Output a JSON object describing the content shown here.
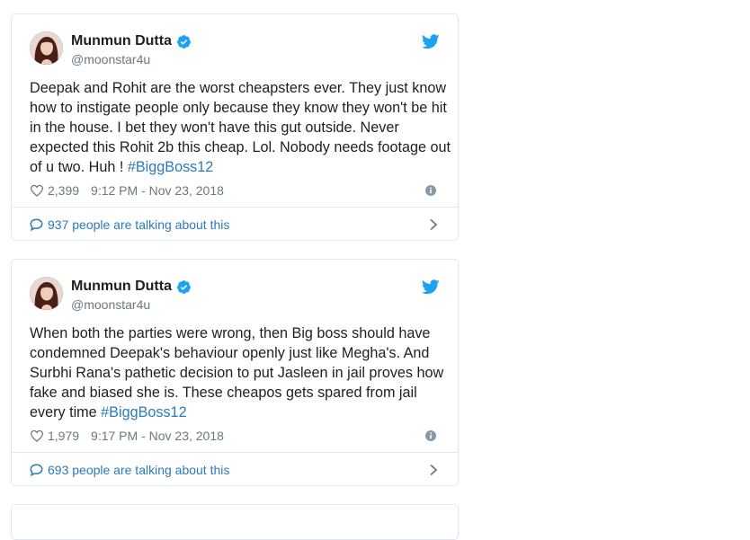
{
  "tweets": [
    {
      "author_name": "Munmun Dutta",
      "handle": "@moonstar4u",
      "text": "Deepak and Rohit are the worst cheapsters ever. They just know how to instigate people only because they know they won't be hit in the house. I bet they won't have this gut outside. Never expected this Rohit 2b this cheap. Lol. Nobody needs footage out of u two. Huh ! ",
      "hashtag": "#BiggBoss12",
      "likes": "2,399",
      "timestamp": "9:12 PM - Nov 23, 2018",
      "talking": "937 people are talking about this"
    },
    {
      "author_name": "Munmun Dutta",
      "handle": "@moonstar4u",
      "text": "When both the parties were wrong, then Big boss should have condemned Deepak's behaviour openly just like Megha's. And Surbhi Rana's pathetic decision to put Jasleen in jail proves how fake and biased she is. These cheapos gets spared from jail every time ",
      "hashtag": "#BiggBoss12",
      "likes": "1,979",
      "timestamp": "9:17 PM - Nov 23, 2018",
      "talking": "693 people are talking about this"
    }
  ],
  "colors": {
    "link": "#2b7bb9",
    "twitter_blue": "#1da1f2",
    "muted": "#697882",
    "border": "#e1e8ed"
  },
  "icons": [
    "verified-icon",
    "twitter-bird-icon",
    "heart-icon",
    "info-icon",
    "speech-bubble-icon",
    "chevron-right-icon"
  ]
}
